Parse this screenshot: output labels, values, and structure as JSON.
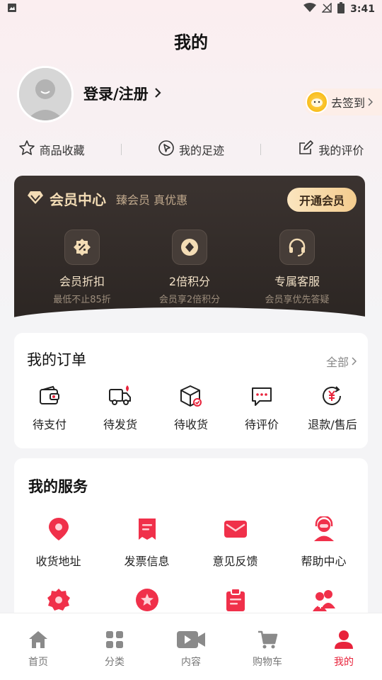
{
  "status_bar": {
    "time": "3:41"
  },
  "page_title": "我的",
  "profile": {
    "login_label": "登录/注册",
    "signin_label": "去签到"
  },
  "quick_links": [
    {
      "label": "商品收藏",
      "icon": "star-icon"
    },
    {
      "label": "我的足迹",
      "icon": "footprint-icon"
    },
    {
      "label": "我的评价",
      "icon": "edit-icon"
    }
  ],
  "vip": {
    "title": "会员中心",
    "subtitle": "臻会员 真优惠",
    "button": "开通会员",
    "perks": [
      {
        "title": "会员折扣",
        "desc": "最低不止85折",
        "icon": "discount-icon"
      },
      {
        "title": "2倍积分",
        "desc": "会员享2倍积分",
        "icon": "points-icon"
      },
      {
        "title": "专属客服",
        "desc": "会员享优先答疑",
        "icon": "headset-icon"
      }
    ]
  },
  "orders": {
    "title": "我的订单",
    "all_label": "全部",
    "items": [
      {
        "label": "待支付",
        "icon": "wallet-icon"
      },
      {
        "label": "待发货",
        "icon": "truck-icon"
      },
      {
        "label": "待收货",
        "icon": "package-icon"
      },
      {
        "label": "待评价",
        "icon": "comment-icon"
      },
      {
        "label": "退款/售后",
        "icon": "refund-icon"
      }
    ]
  },
  "services": {
    "title": "我的服务",
    "items": [
      {
        "label": "收货地址",
        "icon": "location-icon"
      },
      {
        "label": "发票信息",
        "icon": "invoice-icon"
      },
      {
        "label": "意见反馈",
        "icon": "mail-icon"
      },
      {
        "label": "帮助中心",
        "icon": "support-icon"
      }
    ]
  },
  "tabbar": [
    {
      "label": "首页",
      "icon": "home-icon"
    },
    {
      "label": "分类",
      "icon": "category-icon"
    },
    {
      "label": "内容",
      "icon": "video-icon"
    },
    {
      "label": "购物车",
      "icon": "cart-icon"
    },
    {
      "label": "我的",
      "icon": "user-icon",
      "active": true
    }
  ],
  "colors": {
    "accent": "#e8233b",
    "vip_gold": "#f3dcb5",
    "vip_bg": "#2c2623"
  }
}
